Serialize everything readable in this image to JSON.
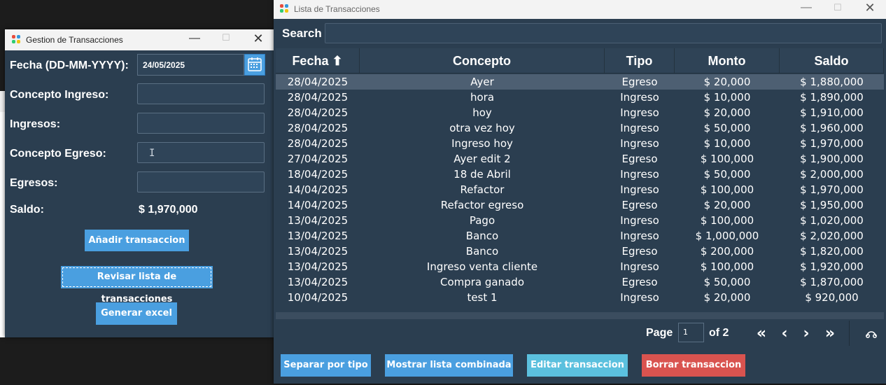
{
  "left_window": {
    "title": "Gestion de Transacciones",
    "fields": {
      "fecha_label": "Fecha (DD-MM-YYYY):",
      "fecha_value": "24/05/2025",
      "concepto_ingreso_label": "Concepto Ingreso:",
      "ingresos_label": "Ingresos:",
      "concepto_egreso_label": "Concepto Egreso:",
      "egresos_label": "Egresos:",
      "saldo_label": "Saldo:",
      "saldo_value": "$ 1,970,000"
    },
    "buttons": {
      "add": "Añadir transaccion",
      "review": "Revisar lista de transacciones",
      "excel": "Generar excel"
    }
  },
  "right_window": {
    "title": "Lista de Transacciones",
    "search_label": "Search",
    "columns": [
      "Fecha ⬆",
      "Concepto",
      "Tipo",
      "Monto",
      "Saldo"
    ],
    "rows": [
      [
        "28/04/2025",
        "Ayer",
        "Egreso",
        "$ 20,000",
        "$ 1,880,000"
      ],
      [
        "28/04/2025",
        "hora",
        "Ingreso",
        "$ 10,000",
        "$ 1,890,000"
      ],
      [
        "28/04/2025",
        "hoy",
        "Ingreso",
        "$ 20,000",
        "$ 1,910,000"
      ],
      [
        "28/04/2025",
        "otra vez hoy",
        "Ingreso",
        "$ 50,000",
        "$ 1,960,000"
      ],
      [
        "28/04/2025",
        "Ingreso hoy",
        "Ingreso",
        "$ 10,000",
        "$ 1,970,000"
      ],
      [
        "27/04/2025",
        "Ayer edit 2",
        "Egreso",
        "$ 100,000",
        "$ 1,900,000"
      ],
      [
        "18/04/2025",
        "18 de Abril",
        "Ingreso",
        "$ 50,000",
        "$ 2,000,000"
      ],
      [
        "14/04/2025",
        "Refactor",
        "Ingreso",
        "$ 100,000",
        "$ 1,970,000"
      ],
      [
        "14/04/2025",
        "Refactor egreso",
        "Egreso",
        "$ 20,000",
        "$ 1,950,000"
      ],
      [
        "13/04/2025",
        "Pago",
        "Ingreso",
        "$ 100,000",
        "$ 1,020,000"
      ],
      [
        "13/04/2025",
        "Banco",
        "Ingreso",
        "$ 1,000,000",
        "$ 2,020,000"
      ],
      [
        "13/04/2025",
        "Banco",
        "Egreso",
        "$ 200,000",
        "$ 1,820,000"
      ],
      [
        "13/04/2025",
        "Ingreso venta cliente",
        "Ingreso",
        "$ 100,000",
        "$ 1,920,000"
      ],
      [
        "13/04/2025",
        "Compra ganado",
        "Egreso",
        "$ 50,000",
        "$ 1,870,000"
      ],
      [
        "10/04/2025",
        "test 1",
        "Ingreso",
        "$ 20,000",
        "$ 920,000"
      ]
    ],
    "pager": {
      "page_label": "Page",
      "page_value": "1",
      "of_label": "of 2",
      "first": "«",
      "prev": "‹",
      "next": "›",
      "last": "»"
    },
    "buttons": {
      "split": "Separar por tipo",
      "combined": "Mostrar lista combinada",
      "edit": "Editar transaccion",
      "delete": "Borrar transaccion"
    }
  },
  "colors": {
    "window_bg": "#2b3e50",
    "primary": "#4a9fe0",
    "info": "#5bc0de",
    "danger": "#d9534f",
    "selected_row": "#4d5f72"
  },
  "icons": [
    "app-icon",
    "calendar-icon",
    "minimize-icon",
    "maximize-icon",
    "close-icon",
    "text-cursor-icon",
    "settings-icon"
  ]
}
